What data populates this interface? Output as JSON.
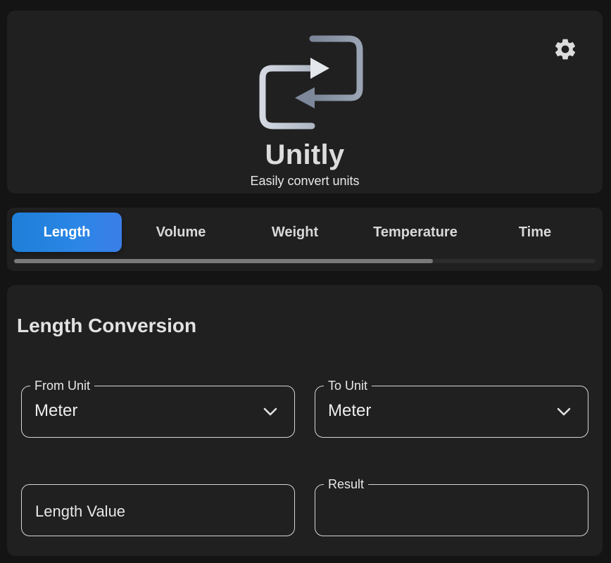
{
  "app": {
    "title": "Unitly",
    "subtitle": "Easily convert units"
  },
  "header": {
    "logo_icon": "swap-arrows-icon",
    "settings_icon": "gear-icon"
  },
  "tabs": [
    {
      "label": "Length",
      "active": true
    },
    {
      "label": "Volume",
      "active": false
    },
    {
      "label": "Weight",
      "active": false
    },
    {
      "label": "Temperature",
      "active": false
    },
    {
      "label": "Time",
      "active": false
    }
  ],
  "tabs_scroll_position": 0.72,
  "conversion": {
    "title": "Length Conversion",
    "from_unit": {
      "label": "From Unit",
      "value": "Meter"
    },
    "to_unit": {
      "label": "To Unit",
      "value": "Meter"
    },
    "value_input": {
      "placeholder": "Length Value"
    },
    "result": {
      "label": "Result",
      "value": ""
    }
  },
  "colors": {
    "accent": "#2b86e6",
    "background": "#141414",
    "card": "#202020"
  }
}
